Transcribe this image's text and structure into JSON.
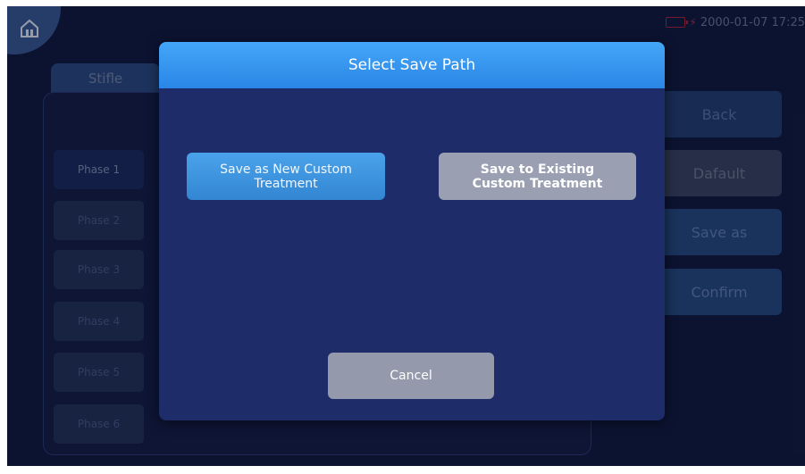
{
  "status": {
    "datetime": "2000-01-07 17:25"
  },
  "tabs": {
    "active_label": "Stifle"
  },
  "phases": [
    "Phase 1",
    "Phase 2",
    "Phase 3",
    "Phase 4",
    "Phase 5",
    "Phase 6"
  ],
  "side_buttons": {
    "back": "Back",
    "default": "Dafault",
    "save_as": "Save as",
    "confirm": "Confirm"
  },
  "dialog": {
    "title": "Select Save Path",
    "new_line1": "Save as New Custom",
    "new_line2": "Treatment",
    "existing_line1": "Save to Existing",
    "existing_line2": "Custom Treatment",
    "cancel": "Cancel"
  },
  "icons": {
    "home": "home-icon",
    "battery": "battery-icon",
    "charging": "bolt-icon"
  },
  "colors": {
    "header": "#2a86e6",
    "background": "#121a3e",
    "dialog": "#1e2d6a",
    "battery_low": "#b3243a"
  }
}
